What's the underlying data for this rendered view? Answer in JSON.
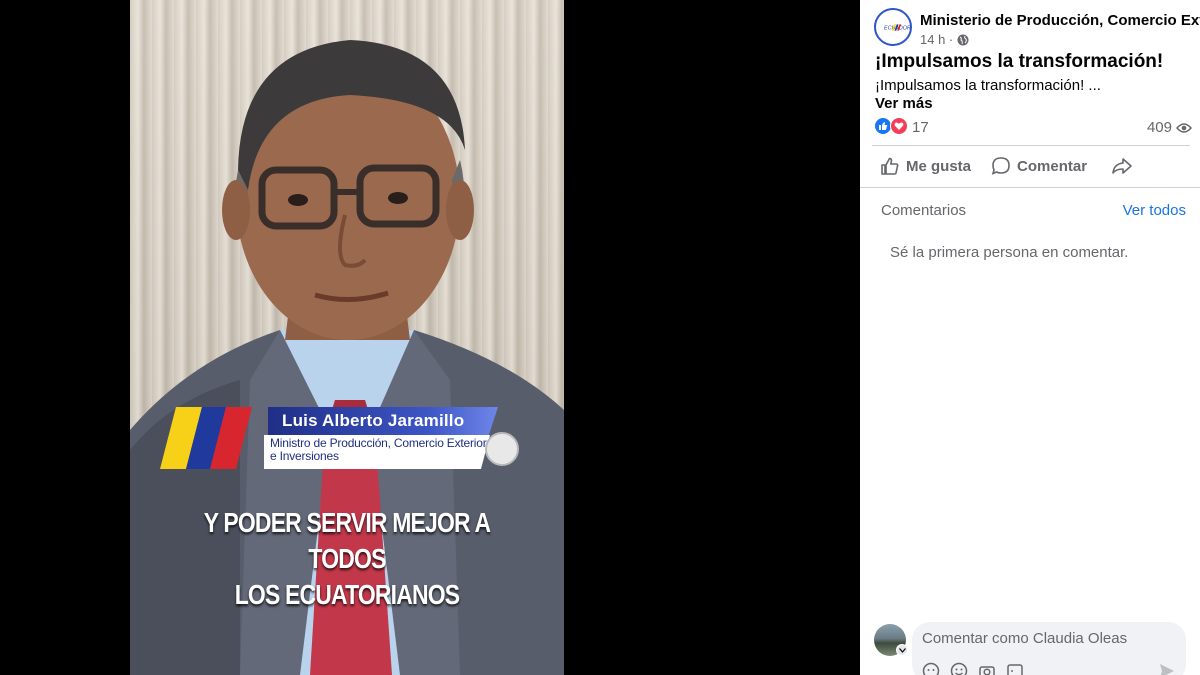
{
  "video": {
    "lower_third_name": "Luis Alberto Jaramillo",
    "lower_third_title": "Ministro de Producción, Comercio Exterior e Inversiones",
    "caption_line1": "Y PODER SERVIR MEJOR A TODOS",
    "caption_line2": "LOS ECUATORIANOS"
  },
  "post": {
    "page_name": "Ministerio de Producción, Comercio Exterior",
    "time": "14 h ·",
    "title": "¡Impulsamos la transformación!",
    "text": "¡Impulsamos la transformación! ...",
    "see_more": "Ver más",
    "reaction_count": "17",
    "views": "409"
  },
  "actions": {
    "like": "Me gusta",
    "comment": "Comentar"
  },
  "comments": {
    "label": "Comentarios",
    "view_all": "Ver todos",
    "empty": "Sé la primera persona en comentar.",
    "placeholder": "Comentar como Claudia Oleas"
  },
  "colors": {
    "accent": "#1b74e4",
    "like": "#1877f2",
    "love": "#f33e58",
    "flag_yellow": "#f7d117",
    "flag_blue": "#1f3a9c",
    "flag_red": "#d7262e"
  },
  "icons": [
    "globe-icon",
    "like-reaction-icon",
    "love-reaction-icon",
    "eye-icon",
    "thumbs-up-icon",
    "comment-bubble-icon",
    "share-icon",
    "chevron-down-icon",
    "sticker-icon",
    "emoji-icon",
    "camera-icon",
    "gif-icon",
    "send-icon"
  ]
}
